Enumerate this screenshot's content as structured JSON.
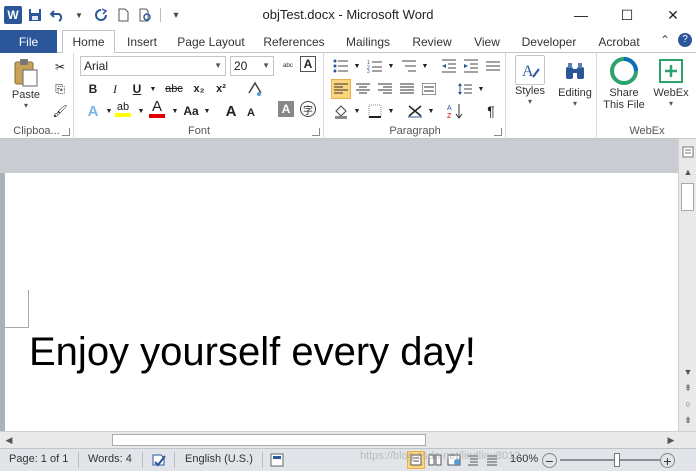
{
  "window": {
    "title": "objTest.docx - Microsoft Word",
    "minimize": "—",
    "maximize": "☐",
    "close": "✕"
  },
  "qat": {
    "app_icon": "W",
    "save_icon": "💾",
    "undo_icon": "↶",
    "redo_icon": "↻",
    "new_icon": "🗋",
    "print_preview_icon": "🔍",
    "customize_icon": "▾"
  },
  "tabs": {
    "file": "File",
    "items": [
      "Home",
      "Insert",
      "Page Layout",
      "References",
      "Mailings",
      "Review",
      "View",
      "Developer",
      "Acrobat"
    ],
    "active": "Home"
  },
  "ribbon": {
    "clipboard": {
      "label": "Clipboa...",
      "paste": "Paste",
      "cut_icon": "✂",
      "copy_icon": "⎘",
      "format_painter_icon": "🖌"
    },
    "font": {
      "label": "Font",
      "font_name": "Arial",
      "font_size": "20",
      "bold": "B",
      "italic": "I",
      "underline": "U",
      "strikethrough": "abc",
      "subscript": "x₂",
      "superscript": "x²",
      "grow": "A",
      "shrink": "A",
      "change_case": "Aa",
      "text_effects": "A",
      "font_color": "A",
      "highlight": "ab"
    },
    "paragraph": {
      "label": "Paragraph"
    },
    "styles": {
      "label": "Styles"
    },
    "editing": {
      "label": "Editing"
    },
    "webex": {
      "share_line1": "Share",
      "share_line2": "This File",
      "webex_btn": "WebEx",
      "label": "WebEx"
    }
  },
  "document": {
    "text": "Enjoy yourself every day!"
  },
  "status": {
    "page": "Page: 1 of 1",
    "words": "Words: 4",
    "language": "English (U.S.)",
    "zoom": "160%",
    "zoom_out": "−",
    "zoom_in": "+"
  },
  "watermark": "https://blog.csdn.net/lindlinu8012"
}
